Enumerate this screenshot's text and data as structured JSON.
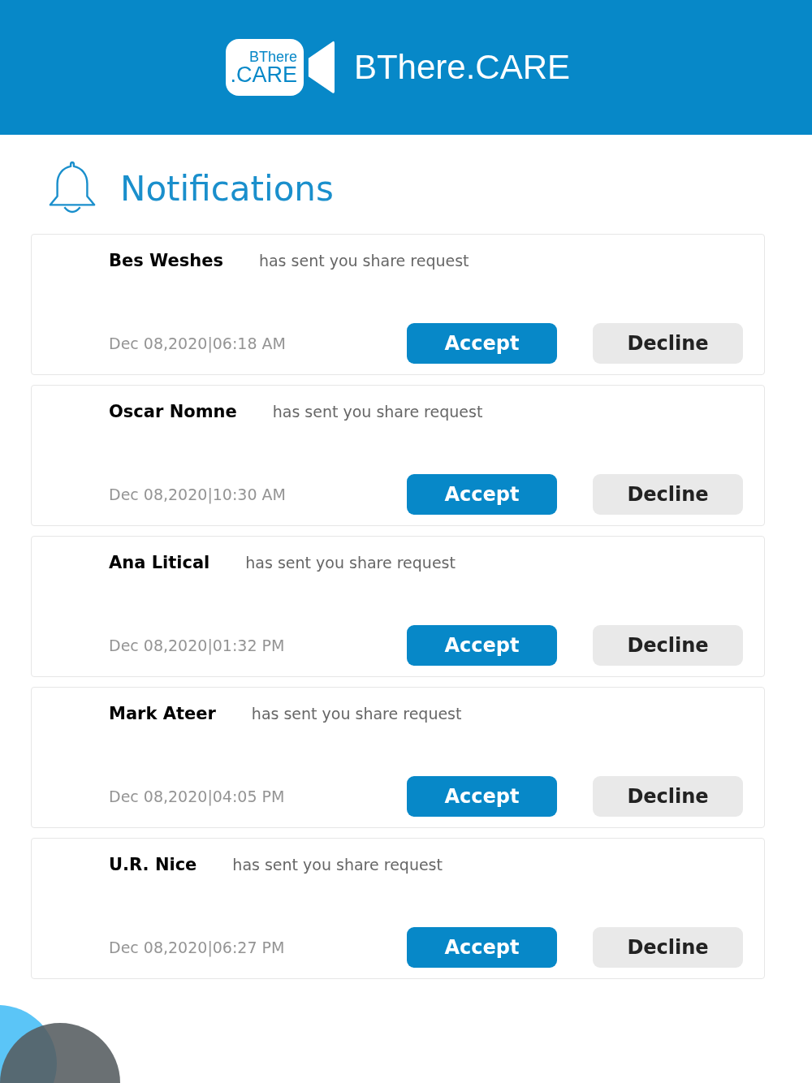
{
  "header": {
    "logo_lines": [
      "BThere",
      ".CARE"
    ],
    "brand": "BThere.CARE"
  },
  "title": "Notifications",
  "notifications": [
    {
      "name": "Bes Weshes",
      "message": "has sent you share request",
      "time": "Dec 08,2020|06:18 AM",
      "accept": "Accept",
      "decline": "Decline"
    },
    {
      "name": "Oscar Nomne",
      "message": "has sent you share request",
      "time": "Dec 08,2020|10:30 AM",
      "accept": "Accept",
      "decline": "Decline"
    },
    {
      "name": "Ana Litical",
      "message": "has sent you share request",
      "time": "Dec 08,2020|01:32 PM",
      "accept": "Accept",
      "decline": "Decline"
    },
    {
      "name": "Mark Ateer",
      "message": "has sent you share request",
      "time": "Dec 08,2020|04:05 PM",
      "accept": "Accept",
      "decline": "Decline"
    },
    {
      "name": "U.R. Nice",
      "message": "has sent you share request",
      "time": "Dec 08,2020|06:27 PM",
      "accept": "Accept",
      "decline": "Decline"
    }
  ]
}
